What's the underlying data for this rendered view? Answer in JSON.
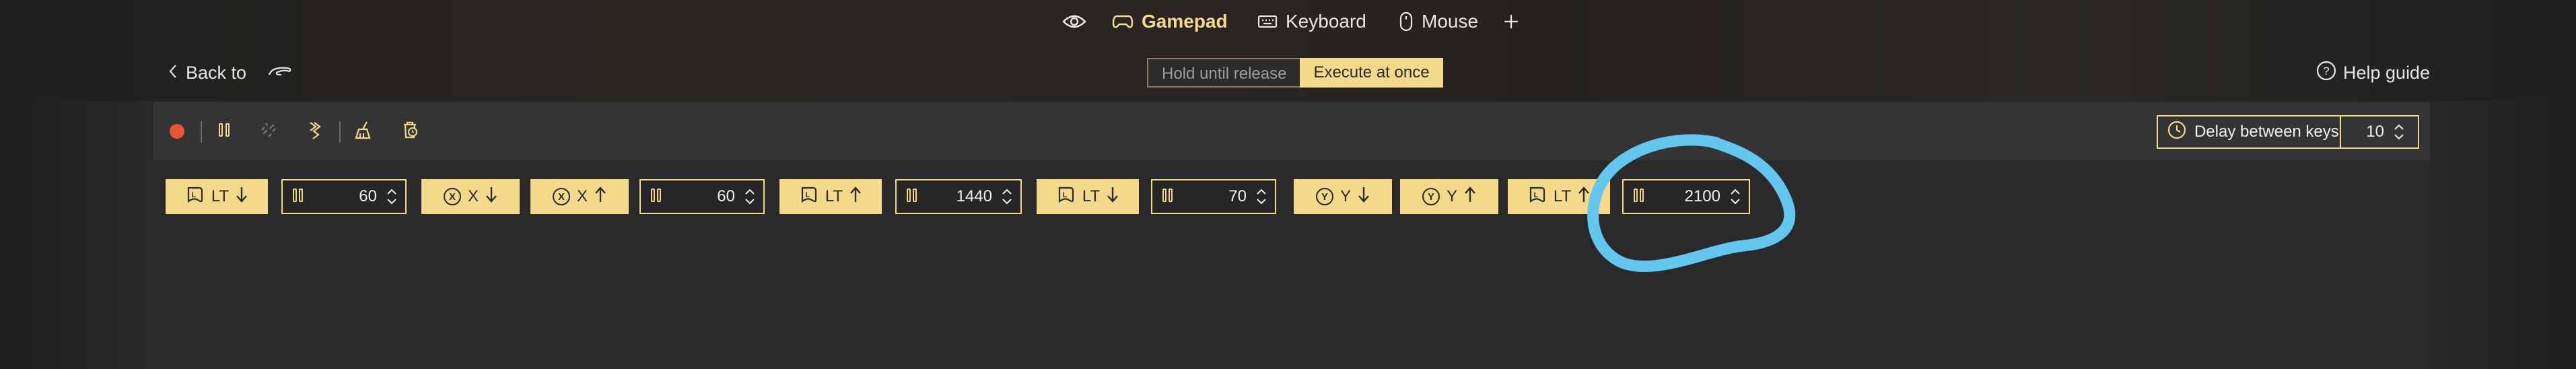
{
  "nav": {
    "eye_icon": "eye-icon",
    "tabs": [
      {
        "label": "Gamepad",
        "icon": "gamepad-icon",
        "active": true
      },
      {
        "label": "Keyboard",
        "icon": "keyboard-icon",
        "active": false
      },
      {
        "label": "Mouse",
        "icon": "mouse-icon",
        "active": false
      }
    ],
    "add_icon": "plus-icon"
  },
  "header": {
    "back_label": "Back to",
    "mode_hold_label": "Hold until release",
    "mode_execute_label": "Execute at once",
    "mode_selected": "Execute at once",
    "help_label": "Help guide"
  },
  "toolbar": {
    "delay_label": "Delay between keys",
    "delay_value": "10"
  },
  "sequence": {
    "steps": [
      {
        "type": "key",
        "button": "LT",
        "action": "down",
        "label": "LT"
      },
      {
        "type": "wait",
        "value": "60"
      },
      {
        "type": "key",
        "button": "X",
        "action": "down",
        "glyph": "X",
        "label": "X"
      },
      {
        "type": "key",
        "button": "X",
        "action": "up",
        "glyph": "X",
        "label": "X"
      },
      {
        "type": "wait",
        "value": "60"
      },
      {
        "type": "key",
        "button": "LT",
        "action": "up",
        "label": "LT"
      },
      {
        "type": "wait",
        "value": "1440"
      },
      {
        "type": "key",
        "button": "LT",
        "action": "down",
        "label": "LT"
      },
      {
        "type": "wait",
        "value": "70"
      },
      {
        "type": "key",
        "button": "Y",
        "action": "down",
        "glyph": "Y",
        "label": "Y"
      },
      {
        "type": "key",
        "button": "Y",
        "action": "up",
        "glyph": "Y",
        "label": "Y"
      },
      {
        "type": "key",
        "button": "LT",
        "action": "up",
        "label": "LT"
      },
      {
        "type": "wait",
        "value": "2100"
      }
    ]
  },
  "colors": {
    "accent": "#f5d98a",
    "record": "#e8562f",
    "annotation": "#63c6ef"
  }
}
